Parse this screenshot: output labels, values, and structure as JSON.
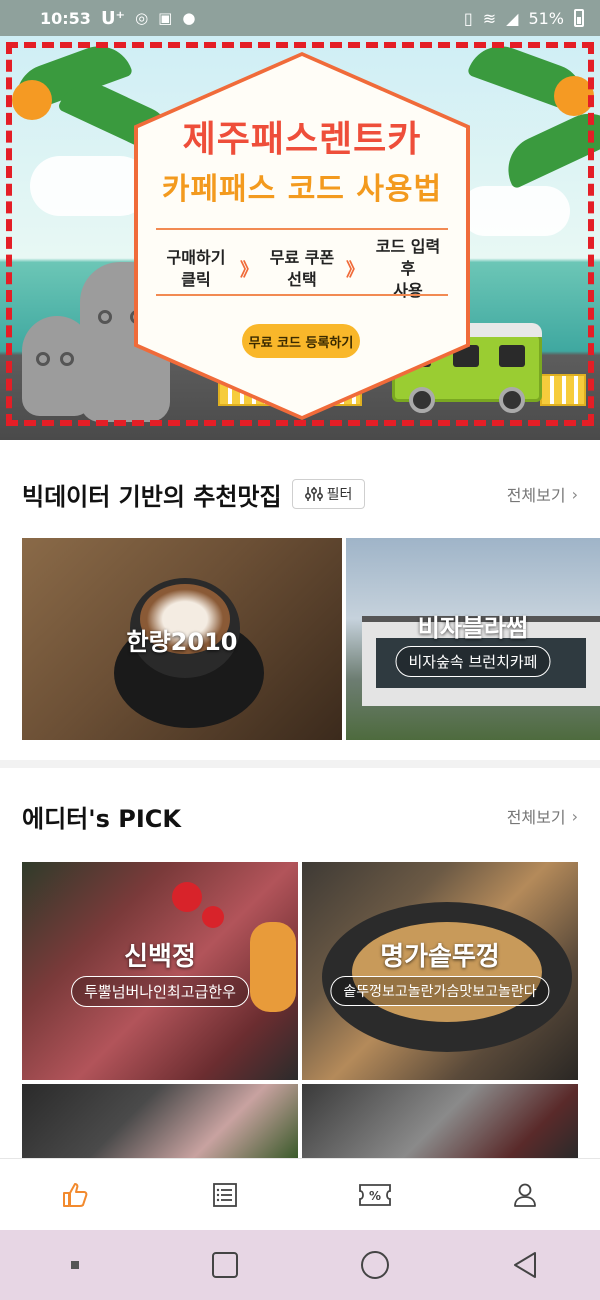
{
  "status_bar": {
    "time": "10:53",
    "carrier": "U⁺",
    "battery_percent": "51%",
    "icons": [
      "instagram-icon",
      "gallery-icon",
      "talk-icon",
      "vibrate-icon",
      "wifi-icon",
      "signal-icon",
      "battery-icon"
    ]
  },
  "banner": {
    "title": "제주패스렌트카",
    "subtitle": "카페패스 코드 사용법",
    "steps": [
      {
        "line1": "구매하기",
        "line2": "클릭"
      },
      {
        "line1": "무료 쿠폰",
        "line2": "선택"
      },
      {
        "line1": "코드 입력 후",
        "line2": "사용"
      }
    ],
    "arrow": "》",
    "cta_label": "무료 코드 등록하기",
    "colors": {
      "border_dash": "#e41e26",
      "title": "#ee4e3a",
      "subtitle": "#f39a1e",
      "cta": "#f9b72a"
    }
  },
  "recommended": {
    "title": "빅데이터 기반의 추천맛집",
    "filter_label": "필터",
    "see_all": "전체보기",
    "cards": [
      {
        "name": "한량2010",
        "tag": ""
      },
      {
        "name": "비자블라썸",
        "tag": "비자숲속 브런치카페"
      }
    ]
  },
  "editors_pick": {
    "title": "에디터's PICK",
    "see_all": "전체보기",
    "cards": [
      {
        "name": "신백정",
        "tag": "투뿔넘버나인최고급한우"
      },
      {
        "name": "명가솥뚜껑",
        "tag": "솥뚜껑보고놀란가슴맛보고놀란다"
      }
    ]
  },
  "bottom_nav": {
    "items": [
      "thumbs-up-icon",
      "list-icon",
      "coupon-icon",
      "profile-icon"
    ],
    "active_color": "#f28a2e",
    "inactive_color": "#444444"
  },
  "system_nav": {
    "items": [
      "recent-apps-dot",
      "square-icon",
      "home-circle-icon",
      "back-triangle-icon"
    ]
  }
}
